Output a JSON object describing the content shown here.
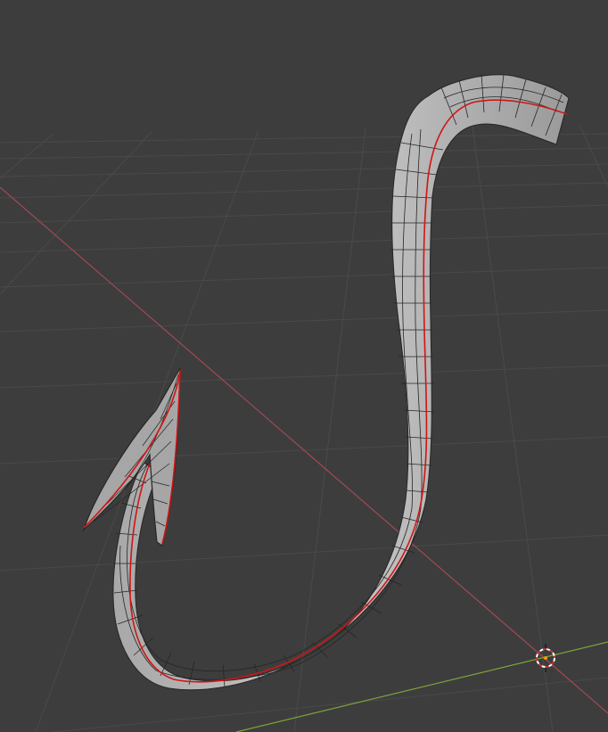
{
  "viewport": {
    "background": "#3d3d3d",
    "grid_color": "#4a4a4a",
    "x_axis_color": "#a14a52",
    "y_axis_color": "#7da33a"
  },
  "mesh": {
    "object": "fish-hook",
    "fill": "#b9b9b9",
    "shade": "#8e8e8e",
    "wire_color": "#262626",
    "seam_color": "#d01515"
  },
  "cursor_3d": {
    "outer_color": "#ffffff",
    "dash_color": "#c83232",
    "center_color": "#f0a000"
  }
}
